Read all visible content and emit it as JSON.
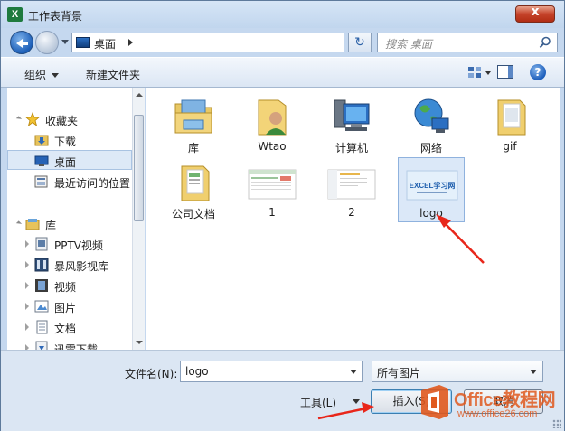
{
  "window": {
    "title": "工作表背景",
    "app_icon_glyph": "X",
    "close_glyph": "x"
  },
  "address": {
    "location": "桌面",
    "search_placeholder": "搜索 桌面",
    "refresh_glyph": "↻"
  },
  "toolbar": {
    "organize_label": "组织",
    "new_folder_label": "新建文件夹",
    "help_glyph": "?"
  },
  "nav": {
    "favorites": {
      "label": "收藏夹",
      "items": [
        {
          "label": "下载",
          "icon": "download-folder-icon"
        },
        {
          "label": "桌面",
          "icon": "desktop-icon",
          "selected": true
        },
        {
          "label": "最近访问的位置",
          "icon": "recent-places-icon"
        }
      ]
    },
    "libraries": {
      "label": "库",
      "items": [
        {
          "label": "PPTV视频",
          "icon": "video-library-icon"
        },
        {
          "label": "暴风影视库",
          "icon": "video-library-icon"
        },
        {
          "label": "视频",
          "icon": "video-library-icon"
        },
        {
          "label": "图片",
          "icon": "pictures-library-icon"
        },
        {
          "label": "文档",
          "icon": "documents-library-icon"
        },
        {
          "label": "迅雷下载",
          "icon": "download-library-icon"
        }
      ]
    }
  },
  "files": [
    {
      "label": "库",
      "icon": "library-folder-icon"
    },
    {
      "label": "Wtao",
      "icon": "user-folder-icon"
    },
    {
      "label": "计算机",
      "icon": "computer-icon"
    },
    {
      "label": "网络",
      "icon": "network-icon"
    },
    {
      "label": "gif",
      "icon": "folder-icon"
    },
    {
      "label": "公司文档",
      "icon": "folder-icon"
    },
    {
      "label": "1",
      "icon": "image-thumbnail-icon"
    },
    {
      "label": "2",
      "icon": "image-thumbnail-icon"
    },
    {
      "label": "logo",
      "icon": "image-thumbnail-icon",
      "selected": true,
      "thumb_text": "EXCEL学习网"
    }
  ],
  "footer": {
    "filename_label": "文件名(N):",
    "filename_value": "logo",
    "filetype_value": "所有图片",
    "tools_label": "工具(L)",
    "insert_label": "插入(S)",
    "cancel_label": "取消"
  },
  "watermark": {
    "text": "Office教程网",
    "url": "www.office26.com"
  },
  "colors": {
    "accent": "#1d5fb8",
    "selection": "#dbe8f8",
    "annotation_arrow": "#e8261a",
    "watermark": "#e0591e"
  }
}
